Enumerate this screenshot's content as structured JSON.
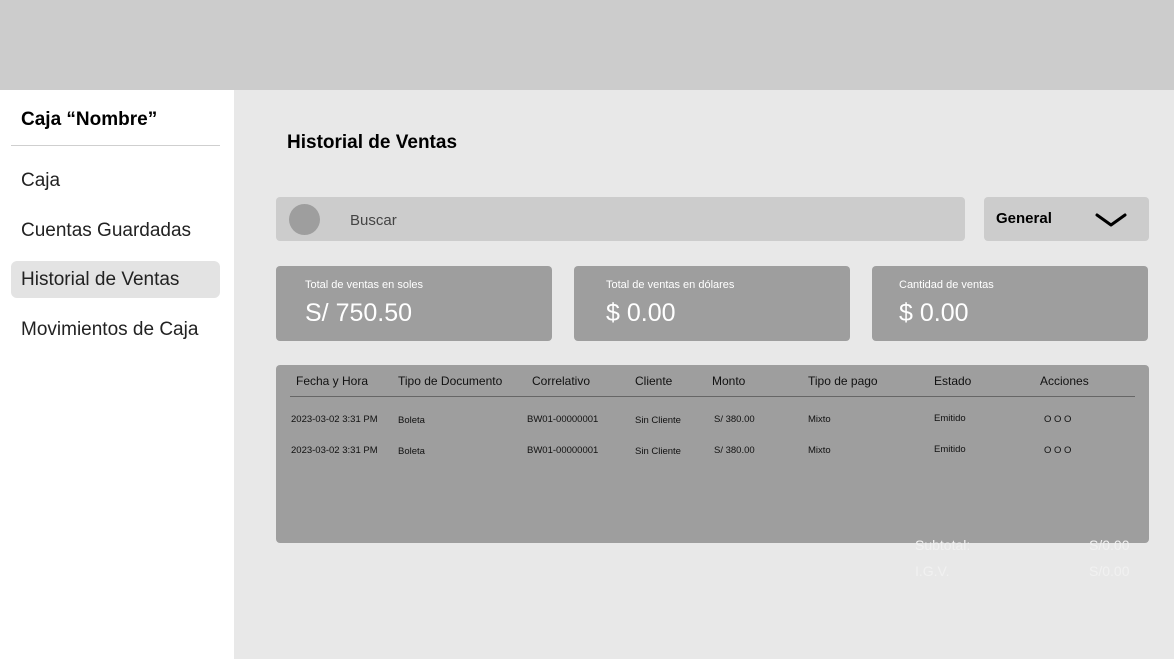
{
  "sidebar": {
    "title": "Caja “Nombre”",
    "items": [
      {
        "label": "Caja",
        "active": false
      },
      {
        "label": "Cuentas Guardadas",
        "active": false
      },
      {
        "label": "Historial de Ventas",
        "active": true
      },
      {
        "label": "Movimientos de Caja",
        "active": false
      }
    ]
  },
  "main": {
    "title": "Historial de Ventas",
    "search": {
      "placeholder": "Buscar",
      "value": ""
    },
    "filter": {
      "selected": "General"
    },
    "cards": [
      {
        "label": "Total de ventas en soles",
        "value": "S/ 750.50"
      },
      {
        "label": "Total de ventas en dólares",
        "value": "$ 0.00"
      },
      {
        "label": "Cantidad de ventas",
        "value": "$ 0.00"
      }
    ],
    "table": {
      "columns": [
        "Fecha y Hora",
        "Tipo de Documento",
        "Correlativo",
        "Cliente",
        "Monto",
        "Tipo de pago",
        "Estado",
        "Acciones"
      ],
      "rows": [
        [
          "2023-03-02 3:31 PM",
          "Boleta",
          "BW01-00000001",
          "Sin Cliente",
          "S/ 380.00",
          "Mixto",
          "Emitido",
          "O O O"
        ],
        [
          "2023-03-02 3:31 PM",
          "Boleta",
          "BW01-00000001",
          "Sin Cliente",
          "S/ 380.00",
          "Mixto",
          "Emitido",
          "O O O"
        ]
      ]
    },
    "totals": [
      {
        "label": "Subtotal:",
        "value": "S/0.00"
      },
      {
        "label": "I.G.V.",
        "value": "S/0.00"
      }
    ]
  },
  "colors": {
    "topbar": "#cccccc",
    "main_bg": "#e8e8e8",
    "card_bg": "#9e9e9e",
    "active_item": "#e3e3e3"
  },
  "icons": {
    "search": "search-icon",
    "dropdown": "chevron-down-icon"
  }
}
